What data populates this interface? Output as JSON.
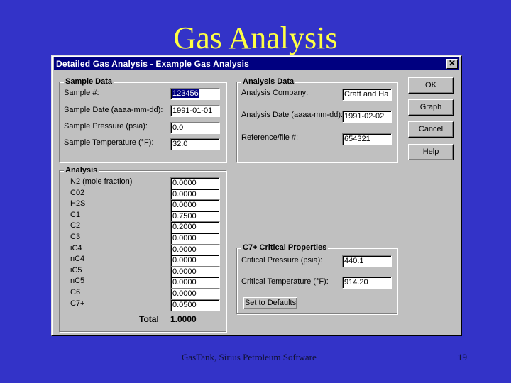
{
  "slide": {
    "title": "Gas Analysis",
    "footer_text": "GasTank, Sirius Petroleum Software",
    "page_number": "19"
  },
  "window": {
    "title": "Detailed Gas Analysis - Example Gas Analysis",
    "close_glyph": "✕"
  },
  "sample_data": {
    "heading": "Sample Data",
    "fields": [
      {
        "label": "Sample #:",
        "value": "123456"
      },
      {
        "label": "Sample Date (aaaa-mm-dd):",
        "value": "1991-01-01"
      },
      {
        "label": "Sample Pressure (psia):",
        "value": "0.0"
      },
      {
        "label": "Sample Temperature (°F):",
        "value": "32.0"
      }
    ]
  },
  "analysis_data": {
    "heading": "Analysis Data",
    "fields": [
      {
        "label": "Analysis Company:",
        "value": "Craft and Ha"
      },
      {
        "label": "Analysis Date (aaaa-mm-dd):",
        "value": "1991-02-02"
      },
      {
        "label": "Reference/file #:",
        "value": "654321"
      }
    ]
  },
  "buttons": {
    "ok": "OK",
    "graph": "Graph",
    "cancel": "Cancel",
    "help": "Help"
  },
  "analysis": {
    "heading": "Analysis",
    "components": [
      {
        "label": "N2 (mole fraction)",
        "value": "0.0000"
      },
      {
        "label": "C02",
        "value": "0.0000"
      },
      {
        "label": "H2S",
        "value": "0.0000"
      },
      {
        "label": "C1",
        "value": "0.7500"
      },
      {
        "label": "C2",
        "value": "0.2000"
      },
      {
        "label": "C3",
        "value": "0.0000"
      },
      {
        "label": "iC4",
        "value": "0.0000"
      },
      {
        "label": "nC4",
        "value": "0.0000"
      },
      {
        "label": "iC5",
        "value": "0.0000"
      },
      {
        "label": "nC5",
        "value": "0.0000"
      },
      {
        "label": "C6",
        "value": "0.0000"
      },
      {
        "label": "C7+",
        "value": "0.0500"
      }
    ],
    "total_label": "Total",
    "total_value": "1.0000"
  },
  "c7_props": {
    "heading": "C7+ Critical Properties",
    "fields": [
      {
        "label": "Critical Pressure (psia):",
        "value": "440.1"
      },
      {
        "label": "Critical Temperature (°F):",
        "value": "914.20"
      }
    ],
    "defaults_button": "Set to Defaults"
  }
}
